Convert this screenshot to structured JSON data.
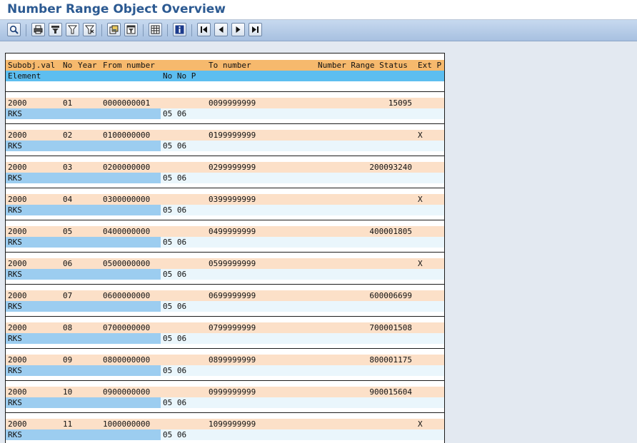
{
  "window": {
    "title": "Number Range Object Overview"
  },
  "toolbar": {
    "buttons": [
      {
        "icon": "zoom-icon"
      },
      {
        "icon": "print-icon"
      },
      {
        "icon": "filter-icon"
      },
      {
        "icon": "set-filter-icon"
      },
      {
        "icon": "delete-filter-icon"
      },
      {
        "icon": "export-icon"
      },
      {
        "icon": "layout-icon"
      },
      {
        "icon": "table-icon"
      },
      {
        "icon": "info-icon"
      },
      {
        "icon": "first-page-icon"
      },
      {
        "icon": "previous-page-icon"
      },
      {
        "icon": "next-page-icon"
      },
      {
        "icon": "last-page-icon"
      }
    ]
  },
  "list": {
    "header1": {
      "subobj": "Subobj.val",
      "no": "No",
      "year": "Year",
      "from": "From number",
      "to": "To number",
      "status": "Number Range Status",
      "ext": "Ext P"
    },
    "header2": {
      "element": "Element",
      "nono": "No No P"
    },
    "rows": [
      {
        "subobj": "2000",
        "no": "01",
        "from": "0000000001",
        "to": "0099999999",
        "status": "15095",
        "ext": "",
        "element": "RKS",
        "nono": "05 06"
      },
      {
        "subobj": "2000",
        "no": "02",
        "from": "0100000000",
        "to": "0199999999",
        "status": "",
        "ext": "X",
        "element": "RKS",
        "nono": "05 06"
      },
      {
        "subobj": "2000",
        "no": "03",
        "from": "0200000000",
        "to": "0299999999",
        "status": "200093240",
        "ext": "",
        "element": "RKS",
        "nono": "05 06"
      },
      {
        "subobj": "2000",
        "no": "04",
        "from": "0300000000",
        "to": "0399999999",
        "status": "",
        "ext": "X",
        "element": "RKS",
        "nono": "05 06"
      },
      {
        "subobj": "2000",
        "no": "05",
        "from": "0400000000",
        "to": "0499999999",
        "status": "400001805",
        "ext": "",
        "element": "RKS",
        "nono": "05 06"
      },
      {
        "subobj": "2000",
        "no": "06",
        "from": "0500000000",
        "to": "0599999999",
        "status": "",
        "ext": "X",
        "element": "RKS",
        "nono": "05 06"
      },
      {
        "subobj": "2000",
        "no": "07",
        "from": "0600000000",
        "to": "0699999999",
        "status": "600006699",
        "ext": "",
        "element": "RKS",
        "nono": "05 06"
      },
      {
        "subobj": "2000",
        "no": "08",
        "from": "0700000000",
        "to": "0799999999",
        "status": "700001508",
        "ext": "",
        "element": "RKS",
        "nono": "05 06"
      },
      {
        "subobj": "2000",
        "no": "09",
        "from": "0800000000",
        "to": "0899999999",
        "status": "800001175",
        "ext": "",
        "element": "RKS",
        "nono": "05 06"
      },
      {
        "subobj": "2000",
        "no": "10",
        "from": "0900000000",
        "to": "0999999999",
        "status": "900015604",
        "ext": "",
        "element": "RKS",
        "nono": "05 06"
      },
      {
        "subobj": "2000",
        "no": "11",
        "from": "1000000000",
        "to": "1099999999",
        "status": "",
        "ext": "X",
        "element": "RKS",
        "nono": "05 06"
      }
    ]
  }
}
